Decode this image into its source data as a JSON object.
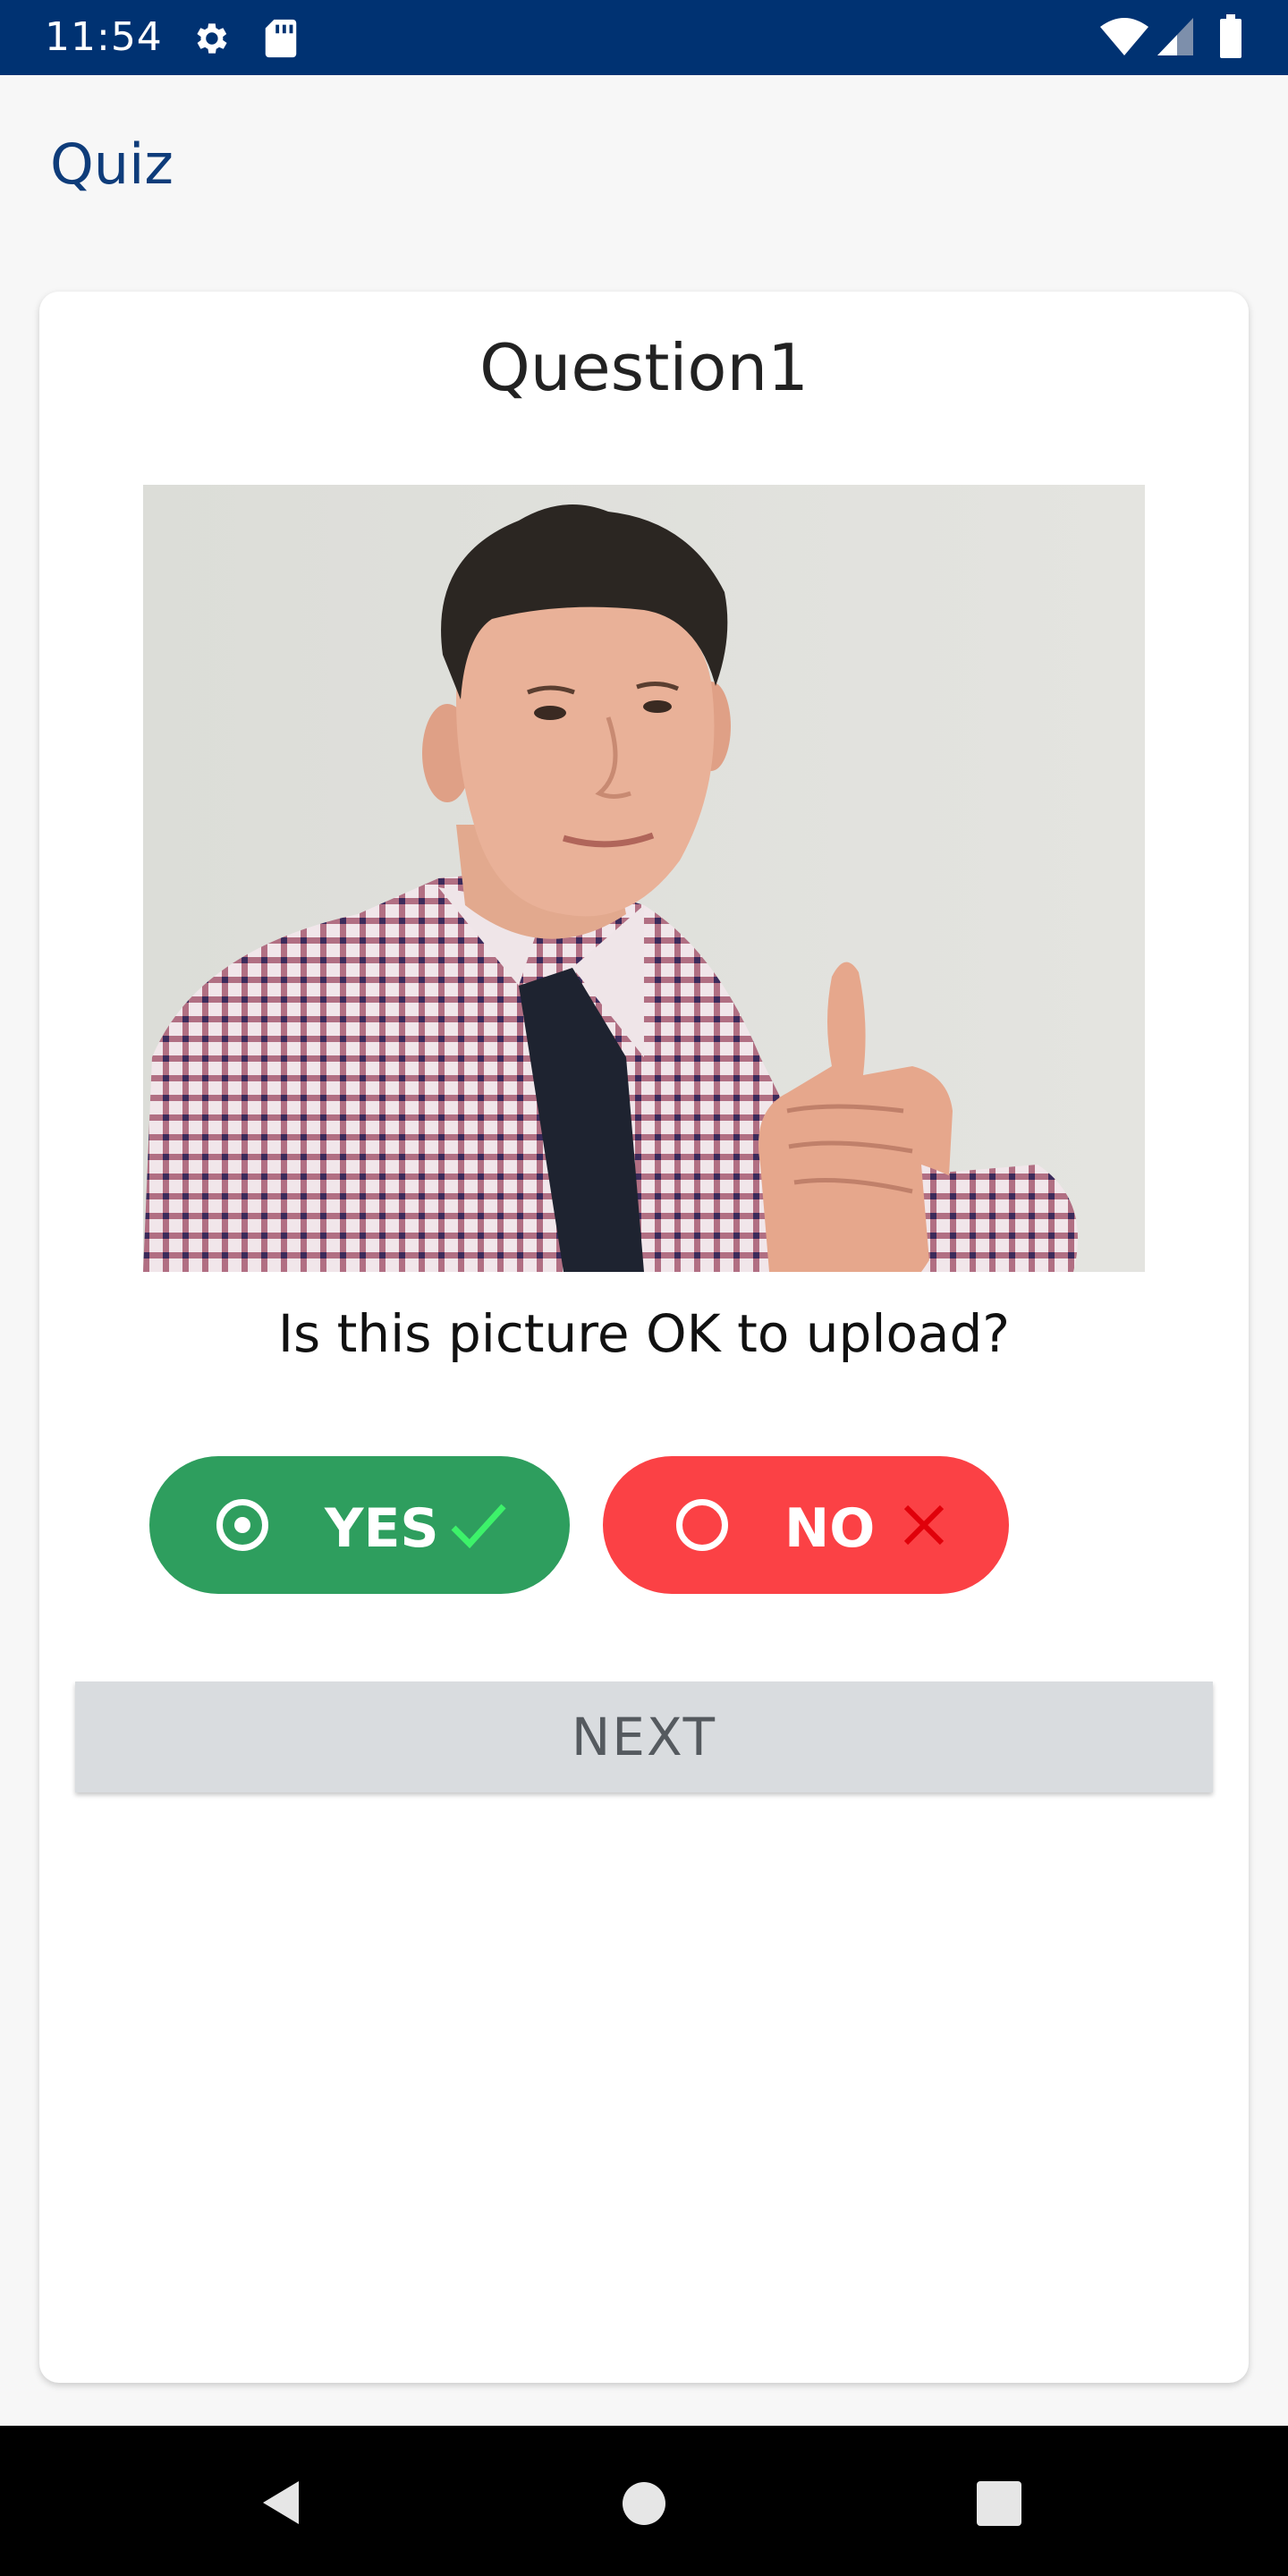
{
  "status_bar": {
    "time": "11:54",
    "icons_left": [
      "settings-icon",
      "sd-card-icon"
    ],
    "icons_right": [
      "wifi-icon",
      "cell-signal-icon",
      "battery-icon"
    ]
  },
  "app_bar": {
    "title": "Quiz"
  },
  "card": {
    "title": "Question1",
    "photo": "photo of man giving thumbs up",
    "question": "Is this picture OK to upload?",
    "options": [
      {
        "label": "YES",
        "selected": true,
        "icon": "check-icon",
        "color": "#2e9e5e",
        "mark_color": "#3df26a"
      },
      {
        "label": "NO",
        "selected": false,
        "icon": "close-icon",
        "color": "#fb4145",
        "mark_color": "#e0000a"
      }
    ],
    "next_label": "NEXT"
  },
  "nav_bar": {
    "buttons": [
      "back-icon",
      "home-icon",
      "recents-icon"
    ]
  },
  "colors": {
    "status_bar": "#003272",
    "title": "#0e3c7a",
    "next_bg": "#d9dcdf"
  }
}
